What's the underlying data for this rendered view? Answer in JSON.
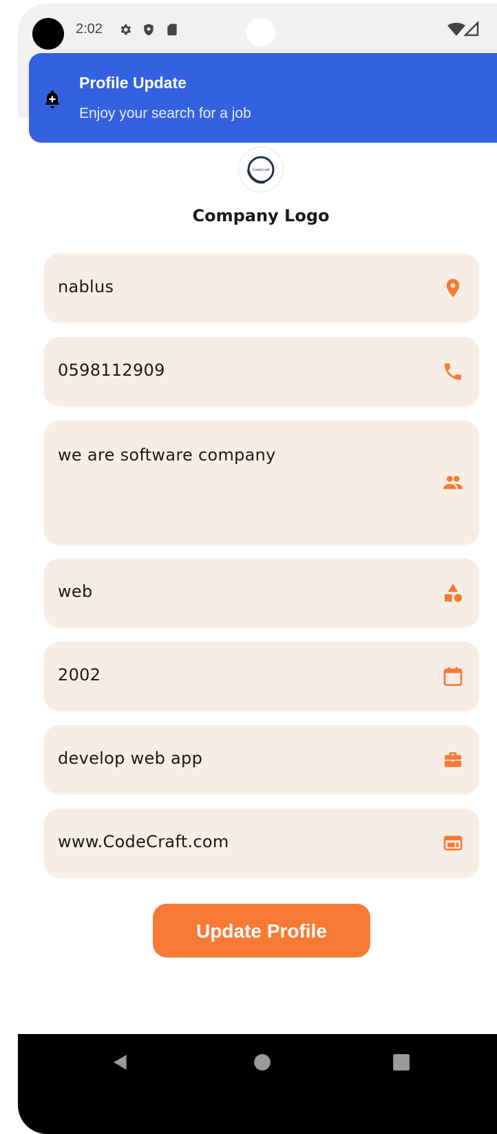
{
  "status_bar": {
    "time": "2:02",
    "icons": [
      "settings-icon",
      "shield-icon",
      "sd-card-icon",
      "wifi-icon",
      "signal-icon"
    ]
  },
  "notification": {
    "icon": "bell-plus-icon",
    "title": "Profile Update",
    "body": "Enjoy your search for a job"
  },
  "logo": {
    "label": "Company Logo",
    "inner_text": "CodeCraft"
  },
  "fields": [
    {
      "value": "nablus",
      "icon": "location-pin-icon"
    },
    {
      "value": "0598112909",
      "icon": "phone-icon"
    },
    {
      "value": "we are software company",
      "icon": "people-icon"
    },
    {
      "value": "web",
      "icon": "category-icon"
    },
    {
      "value": "2002",
      "icon": "calendar-icon"
    },
    {
      "value": "develop web app",
      "icon": "briefcase-icon"
    },
    {
      "value": "www.CodeCraft.com",
      "icon": "web-icon"
    }
  ],
  "update_button": {
    "label": "Update Profile"
  },
  "nav": {
    "buttons": [
      "back-icon",
      "home-icon",
      "recents-icon"
    ]
  },
  "colors": {
    "accent": "#f97a35",
    "field_bg": "#f8ede5",
    "notification_bg": "#3461e0",
    "status_bar_bg": "#f1f1f4"
  }
}
